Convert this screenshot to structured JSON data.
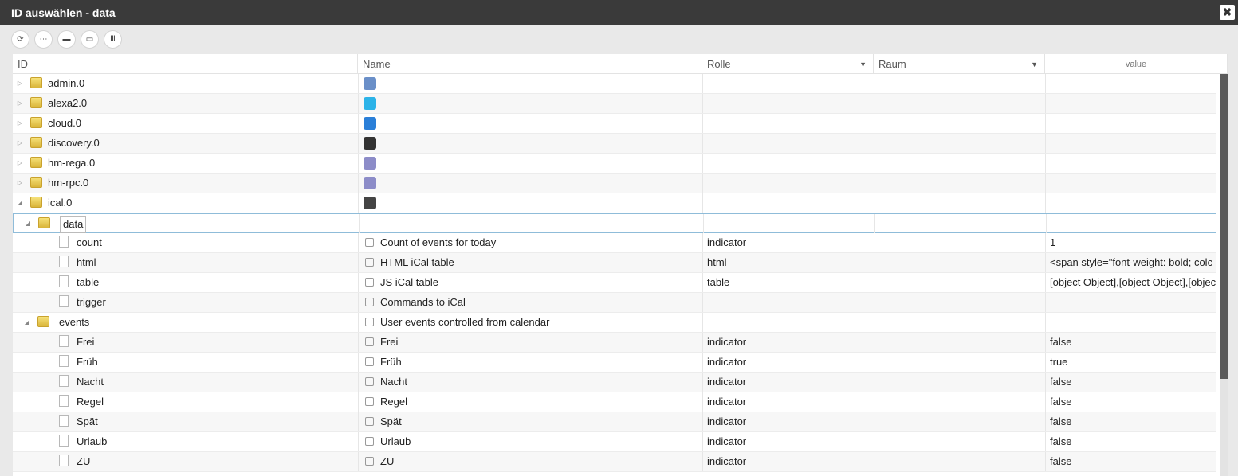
{
  "window": {
    "title": "ID auswählen - data",
    "close_glyph": "✖"
  },
  "toolbar": [
    {
      "name": "refresh-icon",
      "glyph": "⟳"
    },
    {
      "name": "list-icon",
      "glyph": "⋯"
    },
    {
      "name": "folder-closed-icon",
      "glyph": "▬"
    },
    {
      "name": "folder-open-icon",
      "glyph": "▭"
    },
    {
      "name": "columns-icon",
      "glyph": "Ⅲ"
    }
  ],
  "columns": {
    "id": "ID",
    "name": "Name",
    "role": "Rolle",
    "room": "Raum",
    "value": "value"
  },
  "rows": [
    {
      "id": "admin.0",
      "name": "",
      "role": "",
      "value": "",
      "level": 0,
      "kind": "folder",
      "toggle": "▷",
      "icon": "gear-icon",
      "icon_color": "#6a8fc8"
    },
    {
      "id": "alexa2.0",
      "name": "",
      "role": "",
      "value": "",
      "level": 0,
      "kind": "folder",
      "toggle": "▷",
      "icon": "alexa-icon",
      "icon_color": "#2cb3e8"
    },
    {
      "id": "cloud.0",
      "name": "",
      "role": "",
      "value": "",
      "level": 0,
      "kind": "folder",
      "toggle": "▷",
      "icon": "cloud-icon",
      "icon_color": "#2a7fd8"
    },
    {
      "id": "discovery.0",
      "name": "",
      "role": "",
      "value": "",
      "level": 0,
      "kind": "folder",
      "toggle": "▷",
      "icon": "binoculars-icon",
      "icon_color": "#333333"
    },
    {
      "id": "hm-rega.0",
      "name": "",
      "role": "",
      "value": "",
      "level": 0,
      "kind": "folder",
      "toggle": "▷",
      "icon": "homematic-icon",
      "icon_color": "#8c8cc8"
    },
    {
      "id": "hm-rpc.0",
      "name": "",
      "role": "",
      "value": "",
      "level": 0,
      "kind": "folder",
      "toggle": "▷",
      "icon": "homematic-icon",
      "icon_color": "#8c8cc8"
    },
    {
      "id": "ical.0",
      "name": "",
      "role": "",
      "value": "",
      "level": 0,
      "kind": "folder",
      "toggle": "◢",
      "icon": "calendar-icon",
      "icon_color": "#444444"
    },
    {
      "id": "data",
      "name": "",
      "role": "",
      "value": "",
      "level": 1,
      "kind": "folder",
      "toggle": "◢",
      "selected": true
    },
    {
      "id": "count",
      "name": "Count of events for today",
      "role": "indicator",
      "value": "1",
      "level": 2,
      "kind": "file"
    },
    {
      "id": "html",
      "name": "HTML iCal table",
      "role": "html",
      "value": "<span style=\"font-weight: bold; colc",
      "level": 2,
      "kind": "file"
    },
    {
      "id": "table",
      "name": "JS iCal table",
      "role": "table",
      "value": "[object Object],[object Object],[objec",
      "level": 2,
      "kind": "file"
    },
    {
      "id": "trigger",
      "name": "Commands to iCal",
      "role": "",
      "value": "",
      "level": 2,
      "kind": "file"
    },
    {
      "id": "events",
      "name": "User events controlled from calendar",
      "role": "",
      "value": "",
      "level": 1,
      "kind": "folder",
      "toggle": "◢"
    },
    {
      "id": "Frei",
      "name": "Frei",
      "role": "indicator",
      "value": "false",
      "level": 2,
      "kind": "file"
    },
    {
      "id": "Früh",
      "name": "Früh",
      "role": "indicator",
      "value": "true",
      "level": 2,
      "kind": "file"
    },
    {
      "id": "Nacht",
      "name": "Nacht",
      "role": "indicator",
      "value": "false",
      "level": 2,
      "kind": "file"
    },
    {
      "id": "Regel",
      "name": "Regel",
      "role": "indicator",
      "value": "false",
      "level": 2,
      "kind": "file"
    },
    {
      "id": "Spät",
      "name": "Spät",
      "role": "indicator",
      "value": "false",
      "level": 2,
      "kind": "file"
    },
    {
      "id": "Urlaub",
      "name": "Urlaub",
      "role": "indicator",
      "value": "false",
      "level": 2,
      "kind": "file"
    },
    {
      "id": "ZU",
      "name": "ZU",
      "role": "indicator",
      "value": "false",
      "level": 2,
      "kind": "file"
    }
  ]
}
